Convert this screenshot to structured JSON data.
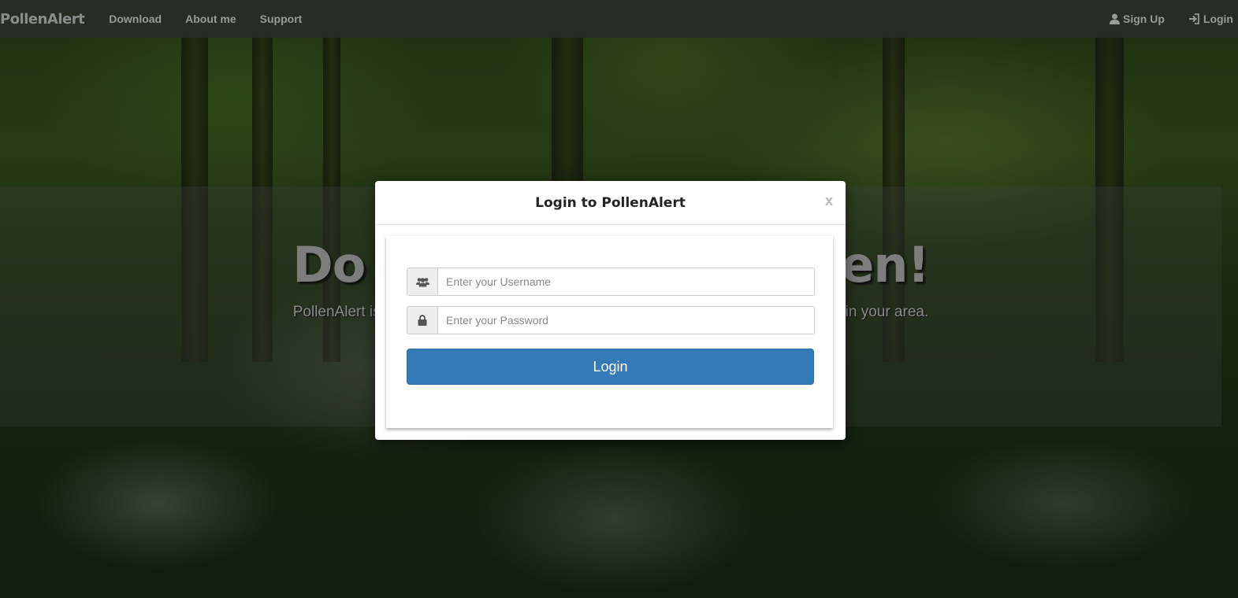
{
  "navbar": {
    "brand": "PollenAlert",
    "links": [
      "Download",
      "About me",
      "Support"
    ],
    "signup_label": "Sign Up",
    "login_label": "Login"
  },
  "hero": {
    "title_left": "Do",
    "title_right": "en!",
    "subtitle_left": "PollenAlert is",
    "subtitle_right": "in your area."
  },
  "modal": {
    "title": "Login to PollenAlert",
    "close_label": "x",
    "username_placeholder": "Enter your Username",
    "password_placeholder": "Enter your Password",
    "login_button_label": "Login"
  },
  "colors": {
    "primary": "#337ab7",
    "navbar_bg": "#2c2f28"
  }
}
